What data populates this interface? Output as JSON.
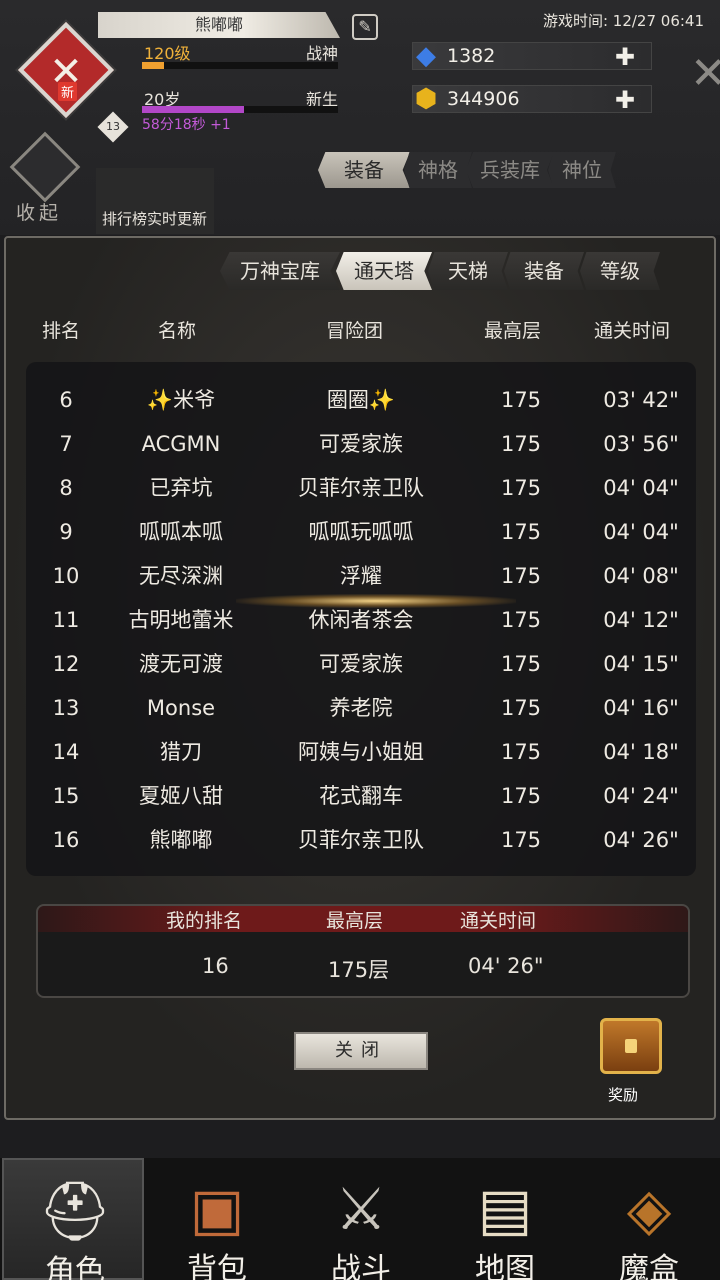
{
  "hud": {
    "player_name": "熊嘟嘟",
    "new_badge": "新",
    "level_badge": "13",
    "level": "120级",
    "title": "战神",
    "level_progress": 0.11,
    "age": "20岁",
    "age_title": "新生",
    "age_progress": 0.52,
    "age_timer": "58分18秒 +1",
    "game_time": "游戏时间: 12/27 06:41",
    "gems": "1382",
    "gold": "344906",
    "collapse_label": "收起",
    "rank_update_text": "排行榜实时更新",
    "tabs": [
      "装备",
      "神格",
      "兵装库",
      "神位"
    ],
    "active_tab": "装备"
  },
  "panel": {
    "tabs": [
      "万神宝库",
      "通天塔",
      "天梯",
      "装备",
      "等级"
    ],
    "tab_labels": [
      "万神宝库",
      "通天塔",
      "天梯",
      "装备",
      "等级"
    ],
    "active_tab": "通天塔",
    "columns": {
      "rank": "排名",
      "name": "名称",
      "team": "冒险团",
      "floor": "最高层",
      "time": "通关时间"
    },
    "rows": [
      {
        "rank": "6",
        "name": "✨米爷",
        "team": "圈圈✨",
        "floor": "175",
        "time": "03' 42\""
      },
      {
        "rank": "7",
        "name": "ACGMN",
        "team": "可爱家族",
        "floor": "175",
        "time": "03' 56\""
      },
      {
        "rank": "8",
        "name": "已弃坑",
        "team": "贝菲尔亲卫队",
        "floor": "175",
        "time": "04' 04\""
      },
      {
        "rank": "9",
        "name": "呱呱本呱",
        "team": "呱呱玩呱呱",
        "floor": "175",
        "time": "04' 04\""
      },
      {
        "rank": "10",
        "name": "无尽深渊",
        "team": "浮耀",
        "floor": "175",
        "time": "04' 08\""
      },
      {
        "rank": "11",
        "name": "古明地蕾米",
        "team": "休闲者茶会",
        "floor": "175",
        "time": "04' 12\""
      },
      {
        "rank": "12",
        "name": "渡无可渡",
        "team": "可爱家族",
        "floor": "175",
        "time": "04' 15\""
      },
      {
        "rank": "13",
        "name": "Monse",
        "team": "养老院",
        "floor": "175",
        "time": "04' 16\""
      },
      {
        "rank": "14",
        "name": "猎刀",
        "team": "阿姨与小姐姐",
        "floor": "175",
        "time": "04' 18\""
      },
      {
        "rank": "15",
        "name": "夏姬八甜",
        "team": "花式翻车",
        "floor": "175",
        "time": "04' 24\""
      },
      {
        "rank": "16",
        "name": "熊嘟嘟",
        "team": "贝菲尔亲卫队",
        "floor": "175",
        "time": "04' 26\""
      }
    ],
    "my_rank": {
      "rank_label": "我的排名",
      "floor_label": "最高层",
      "time_label": "通关时间",
      "rank": "16",
      "floor": "175层",
      "time": "04' 26\""
    },
    "close_label": "关闭",
    "reward_label": "奖励"
  },
  "nav": [
    {
      "label": "角色",
      "icon": "helmet-icon"
    },
    {
      "label": "背包",
      "icon": "backpack-icon"
    },
    {
      "label": "战斗",
      "icon": "sword-shield-icon"
    },
    {
      "label": "地图",
      "icon": "scroll-map-icon"
    },
    {
      "label": "魔盒",
      "icon": "magic-box-icon"
    }
  ],
  "colors": {
    "accent_level": "#f0b23a",
    "accent_age": "#c35ad8",
    "my_rank_header": "#6e1a1a"
  }
}
